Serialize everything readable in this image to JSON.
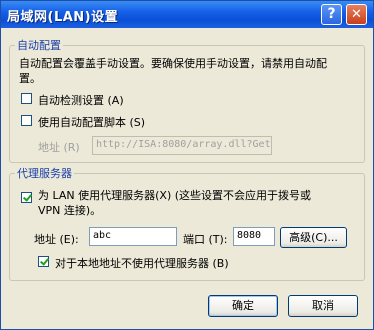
{
  "window": {
    "title": "局域网(LAN)设置"
  },
  "titlebar": {
    "help_glyph": "?",
    "close_glyph": "✕"
  },
  "auto_config": {
    "group_title": "自动配置",
    "description_line1": "自动配置会覆盖手动设置。要确保使用手动设置，请禁用自动配",
    "description_line2": "置。",
    "auto_detect": {
      "label": "自动检测设置 (A)",
      "checked": false
    },
    "use_script": {
      "label": "使用自动配置脚本 (S)",
      "checked": false
    },
    "address_label": "地址 (R)",
    "address_value": "http://ISA:8080/array.dll?Get."
  },
  "proxy": {
    "group_title": "代理服务器",
    "use_proxy_line1": "为 LAN 使用代理服务器(X) (这些设置不会应用于拨号或",
    "use_proxy_line2": "VPN 连接)。",
    "use_proxy_checked": true,
    "address_label": "地址 (E):",
    "address_value": "abc",
    "port_label": "端口 (T):",
    "port_value": "8080",
    "advanced_label": "高级(C)...",
    "bypass_local": {
      "label": "对于本地地址不使用代理服务器 (B)",
      "checked": true
    }
  },
  "buttons": {
    "ok": "确定",
    "cancel": "取消"
  }
}
